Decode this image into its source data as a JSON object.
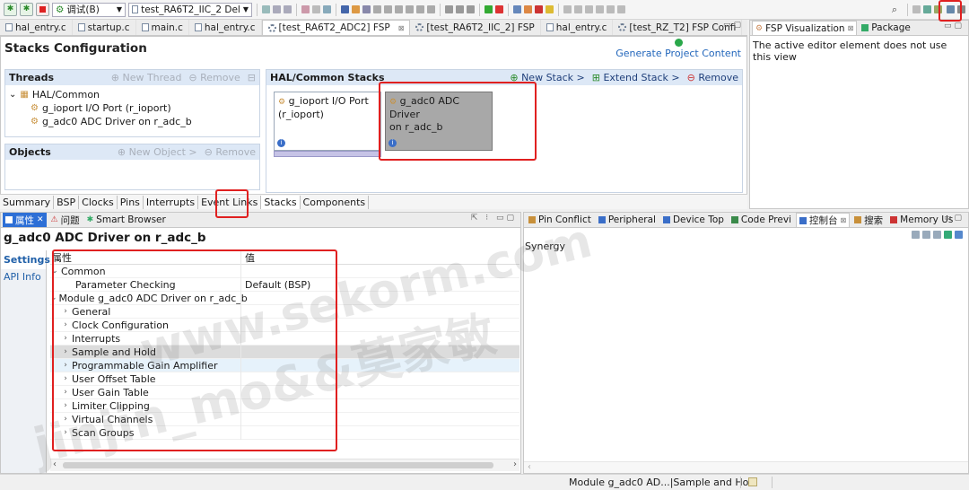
{
  "toolbar": {
    "build_config": "调试(B)",
    "project_combo": "test_RA6T2_IIC_2 Del"
  },
  "editor_tabs": [
    {
      "label": "hal_entry.c",
      "icon": "file-icon"
    },
    {
      "label": "startup.c",
      "icon": "file-icon"
    },
    {
      "label": "main.c",
      "icon": "file-icon"
    },
    {
      "label": "hal_entry.c",
      "icon": "file-icon"
    },
    {
      "label": "[test_RA6T2_ADC2] FSP",
      "icon": "gear-icon",
      "active": true,
      "closable": true
    },
    {
      "label": "[test_RA6T2_IIC_2] FSP",
      "icon": "gear-icon"
    },
    {
      "label": "hal_entry.c",
      "icon": "file-icon"
    },
    {
      "label": "[test_RZ_T2] FSP Confi",
      "icon": "gear-icon"
    }
  ],
  "config": {
    "title": "Stacks Configuration",
    "generate_label": "Generate Project Content",
    "threads": {
      "title": "Threads",
      "new_thread": "New Thread",
      "remove": "Remove",
      "tree": [
        {
          "label": "HAL/Common",
          "level": 0
        },
        {
          "label": "g_ioport I/O Port (r_ioport)",
          "level": 1
        },
        {
          "label": "g_adc0 ADC Driver on r_adc_b",
          "level": 1
        }
      ]
    },
    "objects": {
      "title": "Objects",
      "new_object": "New Object >",
      "remove": "Remove"
    },
    "stacks": {
      "title": "HAL/Common Stacks",
      "new_stack": "New Stack >",
      "extend_stack": "Extend Stack >",
      "remove": "Remove",
      "blocks": [
        {
          "line1": "g_ioport I/O Port",
          "line2": "(r_ioport)",
          "selected": false
        },
        {
          "line1": "g_adc0 ADC Driver",
          "line2": "on r_adc_b",
          "selected": true
        }
      ]
    },
    "bottom_tabs": [
      "Summary",
      "BSP",
      "Clocks",
      "Pins",
      "Interrupts",
      "Event Links",
      "Stacks",
      "Components"
    ],
    "active_bottom_tab": "Stacks"
  },
  "right_top": {
    "tabs": [
      "FSP Visualization",
      "Package"
    ],
    "message": "The active editor element does not use this view"
  },
  "props_view": {
    "tabs": [
      "属性",
      "问题",
      "Smart Browser"
    ],
    "title": "g_adc0 ADC Driver on r_adc_b",
    "side_tabs": [
      "Settings",
      "API Info"
    ],
    "col_property": "属性",
    "col_value": "值",
    "rows": [
      {
        "label": "Common",
        "value": "",
        "level": 0,
        "expander": "open"
      },
      {
        "label": "Parameter Checking",
        "value": "Default (BSP)",
        "level": 2,
        "expander": "none"
      },
      {
        "label": "Module g_adc0 ADC Driver on r_adc_b",
        "value": "",
        "level": 0,
        "expander": "open"
      },
      {
        "label": "General",
        "value": "",
        "level": 1,
        "expander": "closed"
      },
      {
        "label": "Clock Configuration",
        "value": "",
        "level": 1,
        "expander": "closed"
      },
      {
        "label": "Interrupts",
        "value": "",
        "level": 1,
        "expander": "closed"
      },
      {
        "label": "Sample and Hold",
        "value": "",
        "level": 1,
        "expander": "closed",
        "selected": true
      },
      {
        "label": "Programmable Gain Amplifier",
        "value": "",
        "level": 1,
        "expander": "closed",
        "hover": true
      },
      {
        "label": "User Offset Table",
        "value": "",
        "level": 1,
        "expander": "closed"
      },
      {
        "label": "User Gain Table",
        "value": "",
        "level": 1,
        "expander": "closed"
      },
      {
        "label": "Limiter Clipping",
        "value": "",
        "level": 1,
        "expander": "closed"
      },
      {
        "label": "Virtual Channels",
        "value": "",
        "level": 1,
        "expander": "closed"
      },
      {
        "label": "Scan Groups",
        "value": "",
        "level": 1,
        "expander": "closed"
      }
    ]
  },
  "console_view": {
    "tabs": [
      "Pin Conflict",
      "Peripheral",
      "Device Top",
      "Code Previ",
      "控制台",
      "搜索",
      "Memory Us"
    ],
    "active_tab": "控制台",
    "content": "Synergy"
  },
  "status_bar": {
    "text": "Module g_adc0 AD...|Sample and Hold"
  },
  "watermark": {
    "line1": "www.sekorm.com",
    "line2": "jinjin_mo&&莫家敏"
  },
  "colors": {
    "highlight_red": "#e02020",
    "selected_block": "#a8a8a8",
    "panel_header": "#dde8f6",
    "link_blue": "#2266bb"
  }
}
